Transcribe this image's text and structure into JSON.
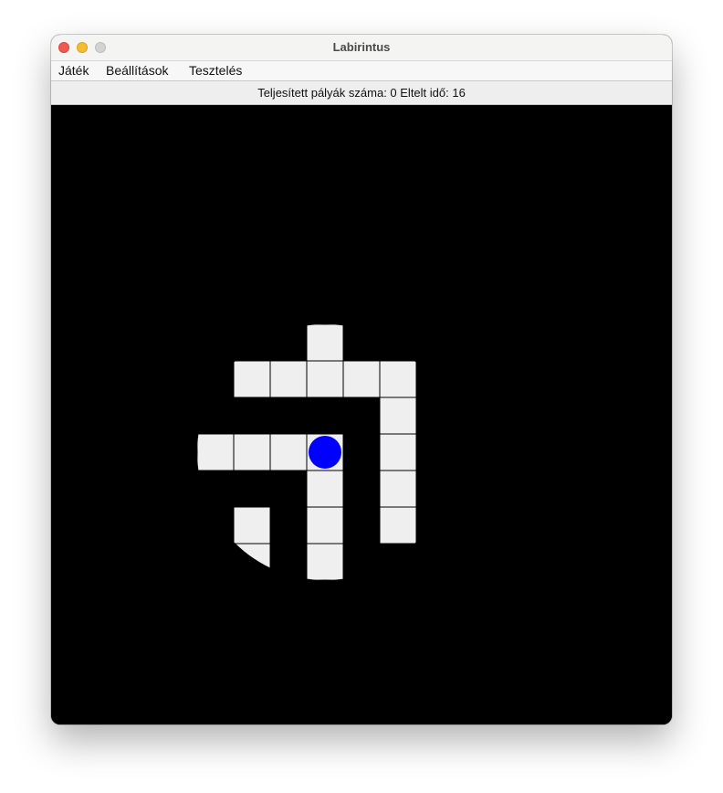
{
  "window": {
    "title": "Labirintus"
  },
  "menu": {
    "items": [
      "Játék",
      "Beállítások",
      "Tesztelés"
    ]
  },
  "status": {
    "text": "Teljesített pályák száma: 0 Eltelt idő: 16"
  },
  "maze": {
    "path_color": "#efefef",
    "wall_color": "#000000",
    "grid_line_color": "#000000",
    "player_color": "#0000ff",
    "cells": [
      [
        3,
        0
      ],
      [
        1,
        1
      ],
      [
        2,
        1
      ],
      [
        3,
        1
      ],
      [
        4,
        1
      ],
      [
        5,
        1
      ],
      [
        5,
        2
      ],
      [
        0,
        3
      ],
      [
        1,
        3
      ],
      [
        2,
        3
      ],
      [
        3,
        3
      ],
      [
        5,
        3
      ],
      [
        3,
        4
      ],
      [
        5,
        4
      ],
      [
        1,
        5
      ],
      [
        3,
        5
      ],
      [
        5,
        5
      ],
      [
        1,
        6
      ],
      [
        3,
        6
      ]
    ],
    "player_cell": [
      3,
      3
    ],
    "visibility": "circular"
  }
}
